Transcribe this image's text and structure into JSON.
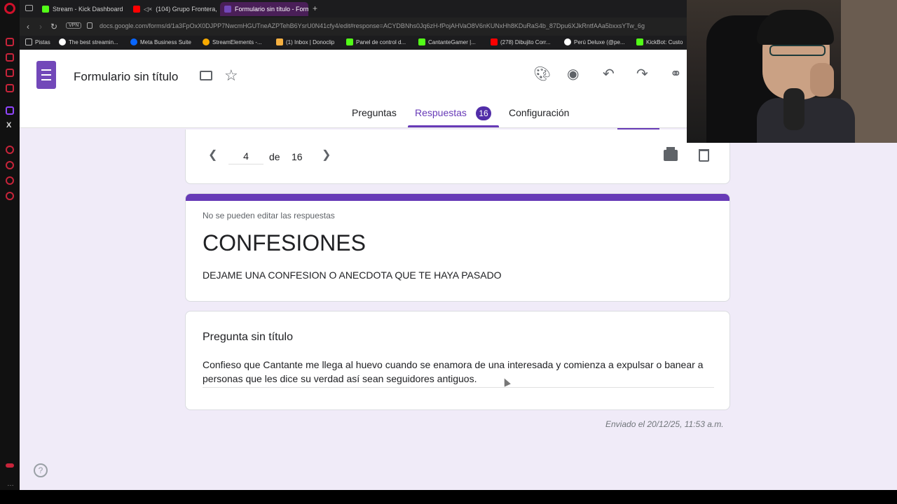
{
  "browser": {
    "tabs": [
      {
        "label": "Stream - Kick Dashboard",
        "color": "#53fc18"
      },
      {
        "label": "(104) Grupo Frontera,",
        "color": "#ff0000"
      },
      {
        "label": "Formulario sin título - Form",
        "color": "#7248b9"
      }
    ],
    "url": "docs.google.com/forms/d/1a3FpOxX0DJPP7NwcmHGUTneAZPTehB6YsrU0N41cfy4/edit#response=ACYDBNhs0Jq6zH-fPojAHVaO8V6nKUNxHh8KDuRaS4b_87Dpu6XJkRntfAAa5bxxsYTw_6g",
    "vpn_label": "VPN",
    "bookmarks": [
      {
        "label": "Pistas",
        "color": "#bbbbbb"
      },
      {
        "label": "The best streamin...",
        "color": "#ffffff"
      },
      {
        "label": "Meta Business Suite",
        "color": "#0866ff"
      },
      {
        "label": "StreamElements -...",
        "color": "#f6a900"
      },
      {
        "label": "(1) Inbox | Donoclip",
        "color": "#f5b041"
      },
      {
        "label": "Panel de control d...",
        "color": "#53fc18"
      },
      {
        "label": "CantanteGamer |...",
        "color": "#53fc18"
      },
      {
        "label": "(278) Dibujito Corr...",
        "color": "#ff0000"
      },
      {
        "label": "Perú Deluxe (@pe...",
        "color": "#ffffff"
      },
      {
        "label": "KickBot: Custo",
        "color": "#53fc18"
      }
    ]
  },
  "form": {
    "title": "Formulario sin título",
    "tabs": {
      "questions": "Preguntas",
      "responses": "Respuestas",
      "responses_count": "16",
      "settings": "Configuración"
    },
    "pager": {
      "current": "4",
      "of_label": "de",
      "total": "16"
    },
    "notice": "No se pueden editar las respuestas",
    "heading": "CONFESIONES",
    "description": "DEJAME UNA CONFESION O ANECDOTA QUE TE HAYA PASADO",
    "question_title": "Pregunta sin título",
    "answer": "Confieso que Cantante me llega al huevo cuando se enamora de una interesada y comienza a expulsar o banear a personas que les dice su verdad así sean seguidores antiguos.",
    "sent_at": "Enviado el 20/12/25, 11:53 a.m.",
    "accent_color": "#673ab7"
  },
  "icons": [
    "palette-icon",
    "eye-icon",
    "undo-icon",
    "redo-icon",
    "link-icon",
    "print-icon",
    "trash-icon",
    "help-icon",
    "folder-icon",
    "star-icon"
  ]
}
